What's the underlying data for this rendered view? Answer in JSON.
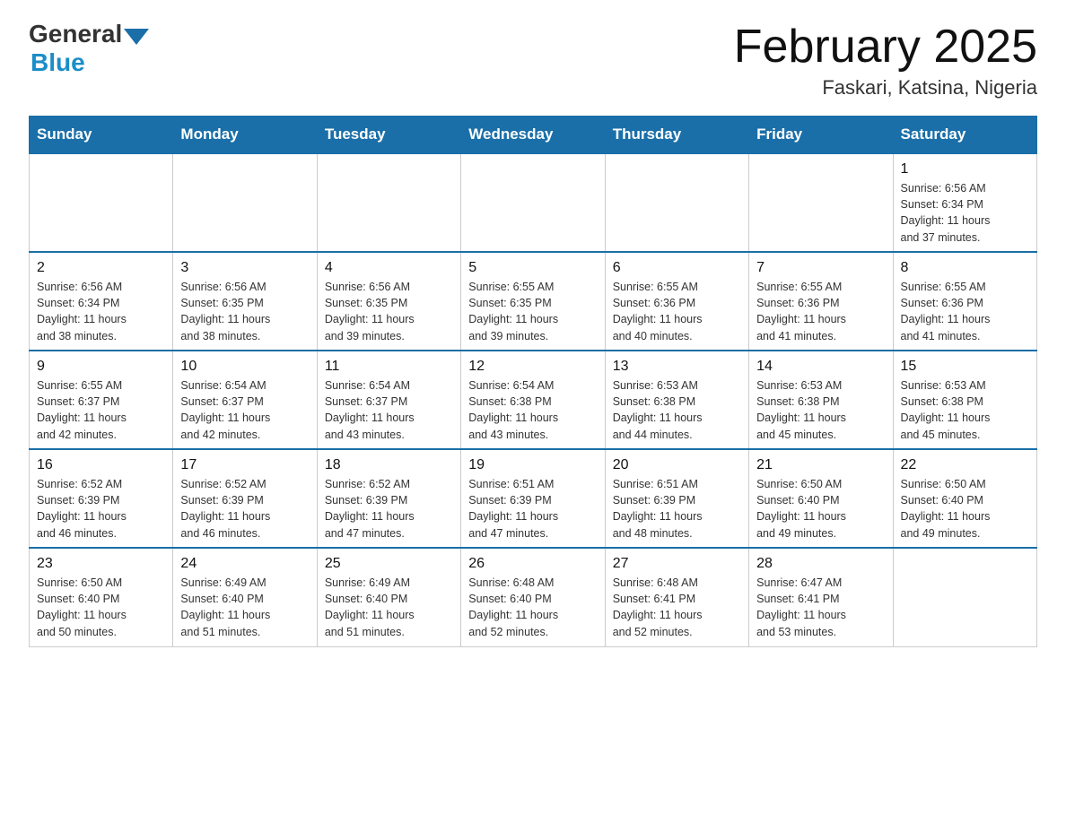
{
  "header": {
    "logo_general": "General",
    "logo_blue": "Blue",
    "month_title": "February 2025",
    "location": "Faskari, Katsina, Nigeria"
  },
  "days_of_week": [
    "Sunday",
    "Monday",
    "Tuesday",
    "Wednesday",
    "Thursday",
    "Friday",
    "Saturday"
  ],
  "weeks": [
    [
      {
        "day": "",
        "info": ""
      },
      {
        "day": "",
        "info": ""
      },
      {
        "day": "",
        "info": ""
      },
      {
        "day": "",
        "info": ""
      },
      {
        "day": "",
        "info": ""
      },
      {
        "day": "",
        "info": ""
      },
      {
        "day": "1",
        "info": "Sunrise: 6:56 AM\nSunset: 6:34 PM\nDaylight: 11 hours\nand 37 minutes."
      }
    ],
    [
      {
        "day": "2",
        "info": "Sunrise: 6:56 AM\nSunset: 6:34 PM\nDaylight: 11 hours\nand 38 minutes."
      },
      {
        "day": "3",
        "info": "Sunrise: 6:56 AM\nSunset: 6:35 PM\nDaylight: 11 hours\nand 38 minutes."
      },
      {
        "day": "4",
        "info": "Sunrise: 6:56 AM\nSunset: 6:35 PM\nDaylight: 11 hours\nand 39 minutes."
      },
      {
        "day": "5",
        "info": "Sunrise: 6:55 AM\nSunset: 6:35 PM\nDaylight: 11 hours\nand 39 minutes."
      },
      {
        "day": "6",
        "info": "Sunrise: 6:55 AM\nSunset: 6:36 PM\nDaylight: 11 hours\nand 40 minutes."
      },
      {
        "day": "7",
        "info": "Sunrise: 6:55 AM\nSunset: 6:36 PM\nDaylight: 11 hours\nand 41 minutes."
      },
      {
        "day": "8",
        "info": "Sunrise: 6:55 AM\nSunset: 6:36 PM\nDaylight: 11 hours\nand 41 minutes."
      }
    ],
    [
      {
        "day": "9",
        "info": "Sunrise: 6:55 AM\nSunset: 6:37 PM\nDaylight: 11 hours\nand 42 minutes."
      },
      {
        "day": "10",
        "info": "Sunrise: 6:54 AM\nSunset: 6:37 PM\nDaylight: 11 hours\nand 42 minutes."
      },
      {
        "day": "11",
        "info": "Sunrise: 6:54 AM\nSunset: 6:37 PM\nDaylight: 11 hours\nand 43 minutes."
      },
      {
        "day": "12",
        "info": "Sunrise: 6:54 AM\nSunset: 6:38 PM\nDaylight: 11 hours\nand 43 minutes."
      },
      {
        "day": "13",
        "info": "Sunrise: 6:53 AM\nSunset: 6:38 PM\nDaylight: 11 hours\nand 44 minutes."
      },
      {
        "day": "14",
        "info": "Sunrise: 6:53 AM\nSunset: 6:38 PM\nDaylight: 11 hours\nand 45 minutes."
      },
      {
        "day": "15",
        "info": "Sunrise: 6:53 AM\nSunset: 6:38 PM\nDaylight: 11 hours\nand 45 minutes."
      }
    ],
    [
      {
        "day": "16",
        "info": "Sunrise: 6:52 AM\nSunset: 6:39 PM\nDaylight: 11 hours\nand 46 minutes."
      },
      {
        "day": "17",
        "info": "Sunrise: 6:52 AM\nSunset: 6:39 PM\nDaylight: 11 hours\nand 46 minutes."
      },
      {
        "day": "18",
        "info": "Sunrise: 6:52 AM\nSunset: 6:39 PM\nDaylight: 11 hours\nand 47 minutes."
      },
      {
        "day": "19",
        "info": "Sunrise: 6:51 AM\nSunset: 6:39 PM\nDaylight: 11 hours\nand 47 minutes."
      },
      {
        "day": "20",
        "info": "Sunrise: 6:51 AM\nSunset: 6:39 PM\nDaylight: 11 hours\nand 48 minutes."
      },
      {
        "day": "21",
        "info": "Sunrise: 6:50 AM\nSunset: 6:40 PM\nDaylight: 11 hours\nand 49 minutes."
      },
      {
        "day": "22",
        "info": "Sunrise: 6:50 AM\nSunset: 6:40 PM\nDaylight: 11 hours\nand 49 minutes."
      }
    ],
    [
      {
        "day": "23",
        "info": "Sunrise: 6:50 AM\nSunset: 6:40 PM\nDaylight: 11 hours\nand 50 minutes."
      },
      {
        "day": "24",
        "info": "Sunrise: 6:49 AM\nSunset: 6:40 PM\nDaylight: 11 hours\nand 51 minutes."
      },
      {
        "day": "25",
        "info": "Sunrise: 6:49 AM\nSunset: 6:40 PM\nDaylight: 11 hours\nand 51 minutes."
      },
      {
        "day": "26",
        "info": "Sunrise: 6:48 AM\nSunset: 6:40 PM\nDaylight: 11 hours\nand 52 minutes."
      },
      {
        "day": "27",
        "info": "Sunrise: 6:48 AM\nSunset: 6:41 PM\nDaylight: 11 hours\nand 52 minutes."
      },
      {
        "day": "28",
        "info": "Sunrise: 6:47 AM\nSunset: 6:41 PM\nDaylight: 11 hours\nand 53 minutes."
      },
      {
        "day": "",
        "info": ""
      }
    ]
  ]
}
